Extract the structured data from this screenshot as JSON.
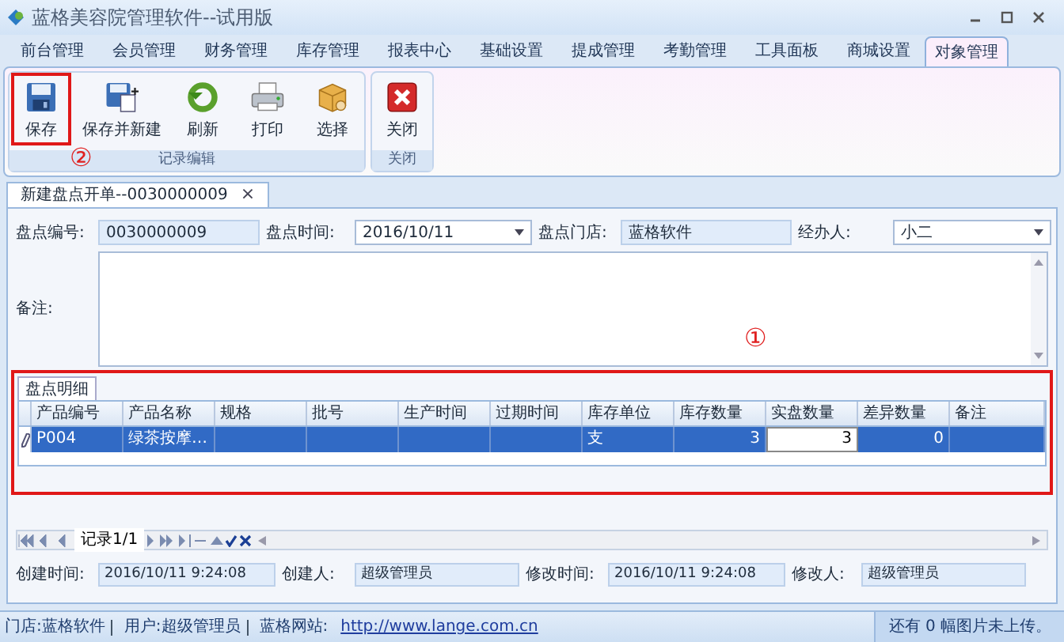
{
  "window": {
    "title": "蓝格美容院管理软件--试用版"
  },
  "menu_tabs": [
    {
      "label": "前台管理",
      "selected": false
    },
    {
      "label": "会员管理",
      "selected": false
    },
    {
      "label": "财务管理",
      "selected": false
    },
    {
      "label": "库存管理",
      "selected": false
    },
    {
      "label": "报表中心",
      "selected": false
    },
    {
      "label": "基础设置",
      "selected": false
    },
    {
      "label": "提成管理",
      "selected": false
    },
    {
      "label": "考勤管理",
      "selected": false
    },
    {
      "label": "工具面板",
      "selected": false
    },
    {
      "label": "商城设置",
      "selected": false
    },
    {
      "label": "对象管理",
      "selected": true
    }
  ],
  "ribbon": [
    {
      "title": "记录编辑",
      "buttons": [
        {
          "label": "保存",
          "kind": "save",
          "highlighted": true
        },
        {
          "label": "保存并新建",
          "kind": "savenew",
          "highlighted": false
        },
        {
          "label": "刷新",
          "kind": "refresh",
          "highlighted": false
        },
        {
          "label": "打印",
          "kind": "print",
          "highlighted": false
        },
        {
          "label": "选择",
          "kind": "select",
          "highlighted": false
        }
      ]
    },
    {
      "title": "关闭",
      "buttons": [
        {
          "label": "关闭",
          "kind": "close",
          "highlighted": false
        }
      ]
    }
  ],
  "annotations": [
    "②",
    "①"
  ],
  "document_tab": {
    "label": "新建盘点开单--0030000009",
    "close": "×"
  },
  "form": {
    "fields": [
      {
        "label": "盘点编号:",
        "value": "0030000009",
        "kind": "readonly"
      },
      {
        "label": "盘点时间:",
        "value": "2016/10/11",
        "kind": "dropdown"
      },
      {
        "label": "盘点门店:",
        "value": "蓝格软件",
        "kind": "readonly"
      },
      {
        "label": "经办人:",
        "value": "小二",
        "kind": "dropdown"
      }
    ],
    "notes": {
      "label": "备注:"
    }
  },
  "detail": {
    "tab": "盘点明细",
    "columns": [
      "产品编号",
      "产品名称",
      "规格",
      "批号",
      "生产时间",
      "过期时间",
      "库存单位",
      "库存数量",
      "实盘数量",
      "差异数量",
      "备注"
    ],
    "rows": [
      {
        "selected": true,
        "cells": [
          "P004",
          "绿茶按摩…",
          "",
          "",
          "",
          "",
          "支",
          "3",
          "3",
          "0",
          ""
        ]
      }
    ],
    "navigator": {
      "record": "记录1/1"
    }
  },
  "footer_fields": [
    {
      "label": "创建时间:",
      "value": "2016/10/11 9:24:08"
    },
    {
      "label": "创建人:",
      "value": "超级管理员"
    },
    {
      "label": "修改时间:",
      "value": "2016/10/11 9:24:08"
    },
    {
      "label": "修改人:",
      "value": "超级管理员"
    }
  ],
  "status_bar": {
    "items": [
      {
        "label": "门店:",
        "value": "蓝格软件"
      },
      {
        "label": "用户:",
        "value": "超级管理员"
      },
      {
        "label": "蓝格网站:",
        "value": "http://www.lange.com.cn",
        "kind": "link"
      }
    ],
    "right": "还有 0 幅图片未上传。"
  }
}
